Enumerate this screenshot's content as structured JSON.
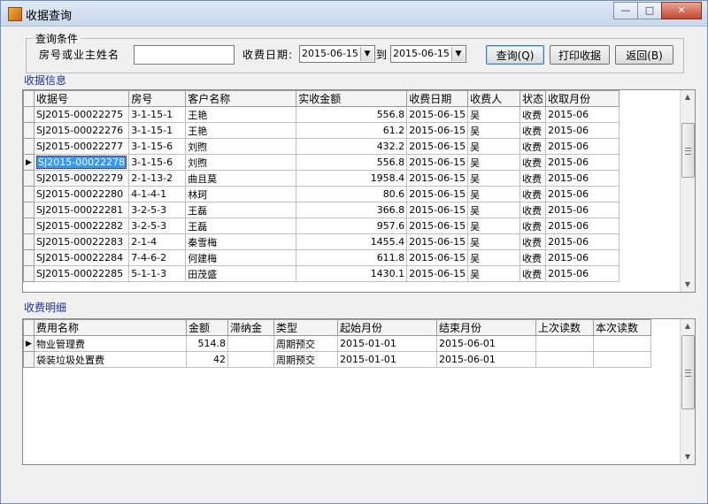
{
  "window": {
    "title": "收据查询"
  },
  "query": {
    "group_title": "查询条件",
    "name_label": "房号或业主姓名",
    "name_value": "",
    "date_label": "收费日期:",
    "date_from": "2015-06-15",
    "to_label": "到",
    "date_to": "2015-06-15",
    "search_button": "查询(Q)",
    "print_button": "打印收据",
    "back_button": "返回(B)"
  },
  "receipts": {
    "title": "收据信息",
    "columns": [
      "收据号",
      "房号",
      "客户名称",
      "实收金额",
      "收费日期",
      "收费人",
      "状态",
      "收取月份"
    ],
    "rows": [
      [
        "SJ2015-00022275",
        "3-1-15-1",
        "王艳",
        "556.8",
        "2015-06-15",
        "吴",
        "收费",
        "2015-06"
      ],
      [
        "SJ2015-00022276",
        "3-1-15-1",
        "王艳",
        "61.2",
        "2015-06-15",
        "吴",
        "收费",
        "2015-06"
      ],
      [
        "SJ2015-00022277",
        "3-1-15-6",
        "刘煦",
        "432.2",
        "2015-06-15",
        "吴",
        "收费",
        "2015-06"
      ],
      [
        "SJ2015-00022278",
        "3-1-15-6",
        "刘煦",
        "556.8",
        "2015-06-15",
        "吴",
        "收费",
        "2015-06"
      ],
      [
        "SJ2015-00022279",
        "2-1-13-2",
        "曲且莫",
        "1958.4",
        "2015-06-15",
        "吴",
        "收费",
        "2015-06"
      ],
      [
        "SJ2015-00022280",
        "4-1-4-1",
        "林珂",
        "80.6",
        "2015-06-15",
        "吴",
        "收费",
        "2015-06"
      ],
      [
        "SJ2015-00022281",
        "3-2-5-3",
        "王磊",
        "366.8",
        "2015-06-15",
        "吴",
        "收费",
        "2015-06"
      ],
      [
        "SJ2015-00022282",
        "3-2-5-3",
        "王磊",
        "957.6",
        "2015-06-15",
        "吴",
        "收费",
        "2015-06"
      ],
      [
        "SJ2015-00022283",
        "2-1-4",
        "秦雪梅",
        "1455.4",
        "2015-06-15",
        "吴",
        "收费",
        "2015-06"
      ],
      [
        "SJ2015-00022284",
        "7-4-6-2",
        "何建梅",
        "611.8",
        "2015-06-15",
        "吴",
        "收费",
        "2015-06"
      ],
      [
        "SJ2015-00022285",
        "5-1-1-3",
        "田茂盛",
        "1430.1",
        "2015-06-15",
        "吴",
        "收费",
        "2015-06"
      ]
    ],
    "current_row": 3
  },
  "details": {
    "title": "收费明细",
    "columns": [
      "费用名称",
      "金额",
      "滞纳金",
      "类型",
      "起始月份",
      "结束月份",
      "上次读数",
      "本次读数"
    ],
    "rows": [
      [
        "物业管理费",
        "514.8",
        "",
        "周期预交",
        "2015-01-01",
        "2015-06-01",
        "",
        ""
      ],
      [
        "袋装垃圾处置费",
        "42",
        "",
        "周期预交",
        "2015-01-01",
        "2015-06-01",
        "",
        ""
      ]
    ],
    "current_row": 0
  },
  "icons": {
    "current_row_marker": "triangle-right-icon",
    "scroll_up": "arrow-up-icon",
    "scroll_down": "arrow-down-icon"
  }
}
